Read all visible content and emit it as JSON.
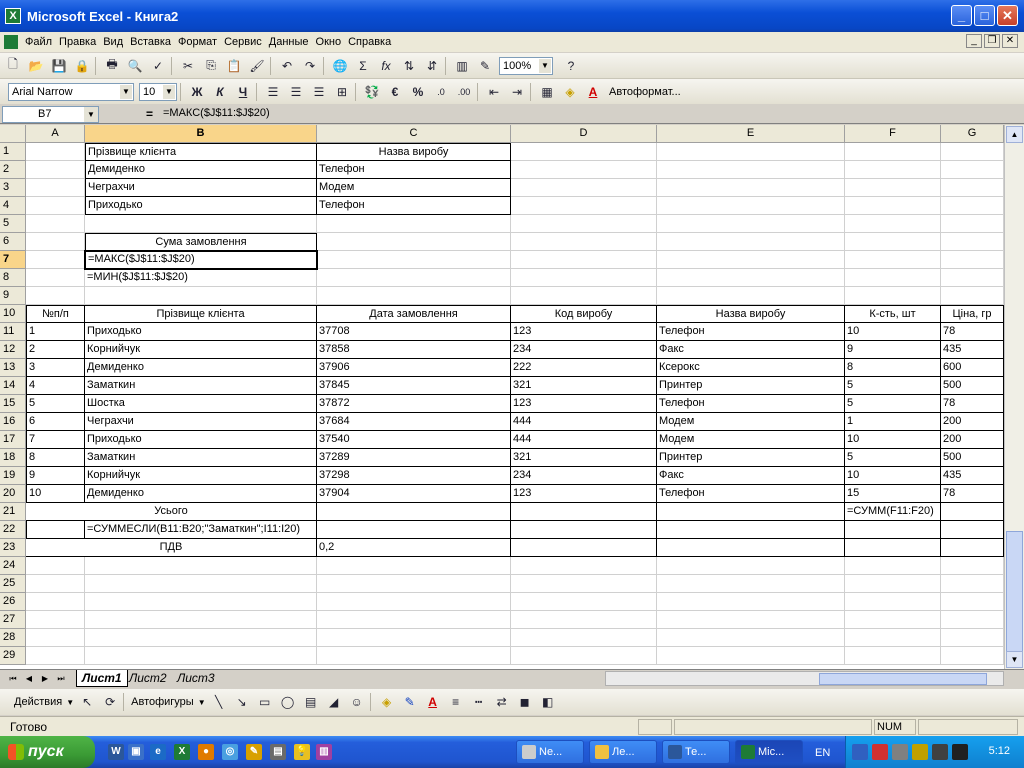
{
  "window": {
    "title": "Microsoft Excel - Книга2",
    "app_icon": "X"
  },
  "menu": [
    "Файл",
    "Правка",
    "Вид",
    "Вставка",
    "Формат",
    "Сервис",
    "Данные",
    "Окно",
    "Справка"
  ],
  "toolbar": {
    "zoom": "100%",
    "autoformat_label": "Автоформат..."
  },
  "format_toolbar": {
    "font": "Arial Narrow",
    "size": "10",
    "bold": "Ж",
    "italic": "К",
    "underline": "Ч",
    "currency": "€",
    "percent": "%"
  },
  "formula_bar": {
    "cell_ref": "B7",
    "eq": "=",
    "formula": "=МАКС($J$11:$J$20)"
  },
  "columns": [
    "A",
    "B",
    "C",
    "D",
    "E",
    "F",
    "G"
  ],
  "rows": [
    "1",
    "2",
    "3",
    "4",
    "5",
    "6",
    "7",
    "8",
    "9",
    "10",
    "11",
    "12",
    "13",
    "14",
    "15",
    "16",
    "17",
    "18",
    "19",
    "20",
    "21",
    "22",
    "23",
    "24",
    "25",
    "26",
    "27",
    "28",
    "29"
  ],
  "cells": {
    "B1": "Прізвище клієнта",
    "C1": "Назва виробу",
    "B2": "Демиденко",
    "C2": "Телефон",
    "B3": "Чеграхчи",
    "C3": "Модем",
    "B4": "Приходько",
    "C4": "Телефон",
    "B6": "Сума замовлення",
    "B7": "=МАКС($J$11:$J$20)",
    "B8": "=МИН($J$11:$J$20)",
    "A10": "№п/п",
    "B10": "Прізвище клієнта",
    "C10": "Дата замовлення",
    "D10": "Код виробу",
    "E10": "Назва виробу",
    "F10": "К-сть, шт",
    "G10": "Ціна, гр",
    "B21": "Усього",
    "F21": "=СУММ(F11:F20)",
    "B22": "=СУММЕСЛИ(B11:B20;\"Заматкин\";I11:I20)",
    "B23": "ПДВ",
    "C23": "0,2"
  },
  "table": [
    [
      "1",
      "Приходько",
      "37708",
      "123",
      "Телефон",
      "10",
      "78"
    ],
    [
      "2",
      "Корнийчук",
      "37858",
      "234",
      "Факс",
      "9",
      "435"
    ],
    [
      "3",
      "Демиденко",
      "37906",
      "222",
      "Ксерокс",
      "8",
      "600"
    ],
    [
      "4",
      "Заматкин",
      "37845",
      "321",
      "Принтер",
      "5",
      "500"
    ],
    [
      "5",
      "Шостка",
      "37872",
      "123",
      "Телефон",
      "5",
      "78"
    ],
    [
      "6",
      "Чеграхчи",
      "37684",
      "444",
      "Модем",
      "1",
      "200"
    ],
    [
      "7",
      "Приходько",
      "37540",
      "444",
      "Модем",
      "10",
      "200"
    ],
    [
      "8",
      "Заматкин",
      "37289",
      "321",
      "Принтер",
      "5",
      "500"
    ],
    [
      "9",
      "Корнийчук",
      "37298",
      "234",
      "Факс",
      "10",
      "435"
    ],
    [
      "10",
      "Демиденко",
      "37904",
      "123",
      "Телефон",
      "15",
      "78"
    ]
  ],
  "sheets": [
    "Лист1",
    "Лист2",
    "Лист3"
  ],
  "drawing": {
    "actions": "Действия",
    "autoshapes": "Автофигуры"
  },
  "status": {
    "ready": "Готово",
    "num": "NUM"
  },
  "taskbar": {
    "start": "пуск",
    "tasks": [
      "Ne...",
      "Ле...",
      "Те...",
      "Mic..."
    ],
    "lang": "EN",
    "clock": "5:12"
  }
}
